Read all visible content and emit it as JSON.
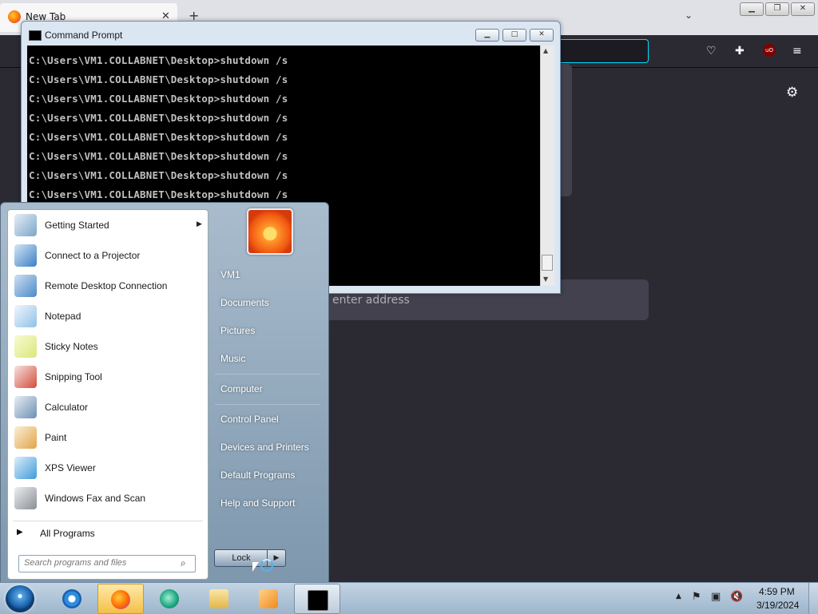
{
  "firefox": {
    "tab_title": "New Tab",
    "tab_close": "✕",
    "new_tab": "+",
    "list_tabs": "⌄",
    "search_placeholder": "enter address",
    "ublock_label": "uO",
    "icons": [
      "pocket-icon",
      "extensions-icon",
      "ublock-icon",
      "menu-icon",
      "settings-gear-icon"
    ]
  },
  "outer_window": {
    "minimize": "▁",
    "maximize": "❐",
    "close": "✕"
  },
  "cmd": {
    "title": "Command Prompt",
    "minimize": "▁",
    "maximize": "□",
    "close": "✕",
    "lines": [
      "C:\\Users\\VM1.COLLABNET\\Desktop>shutdown /s",
      "C:\\Users\\VM1.COLLABNET\\Desktop>shutdown /s",
      "C:\\Users\\VM1.COLLABNET\\Desktop>shutdown /s",
      "C:\\Users\\VM1.COLLABNET\\Desktop>shutdown /s",
      "C:\\Users\\VM1.COLLABNET\\Desktop>shutdown /s",
      "C:\\Users\\VM1.COLLABNET\\Desktop>shutdown /s",
      "C:\\Users\\VM1.COLLABNET\\Desktop>shutdown /s",
      "C:\\Users\\VM1.COLLABNET\\Desktop>shutdown /s"
    ]
  },
  "start_menu": {
    "programs": [
      {
        "label": "Getting Started",
        "icon": "getting-started-icon",
        "color": "#7aa6c9"
      },
      {
        "label": "Connect to a Projector",
        "icon": "projector-icon",
        "color": "#3b7fc4"
      },
      {
        "label": "Remote Desktop Connection",
        "icon": "remote-desktop-icon",
        "color": "#4b89c8"
      },
      {
        "label": "Notepad",
        "icon": "notepad-icon",
        "color": "#8fc0e8"
      },
      {
        "label": "Sticky Notes",
        "icon": "sticky-notes-icon",
        "color": "#d9e77a"
      },
      {
        "label": "Snipping Tool",
        "icon": "snipping-tool-icon",
        "color": "#d44c3c"
      },
      {
        "label": "Calculator",
        "icon": "calculator-icon",
        "color": "#6d8fb3"
      },
      {
        "label": "Paint",
        "icon": "paint-icon",
        "color": "#e0a548"
      },
      {
        "label": "XPS Viewer",
        "icon": "xps-viewer-icon",
        "color": "#3f9bd9"
      },
      {
        "label": "Windows Fax and Scan",
        "icon": "fax-scan-icon",
        "color": "#8a8f96"
      }
    ],
    "getting_started_arrow": "▶",
    "all_programs_arrow": "▶",
    "all_programs": "All Programs",
    "search_placeholder": "Search programs and files",
    "search_icon": "⌕",
    "right_links": [
      "VM1",
      "Documents",
      "Pictures",
      "Music",
      "Computer",
      "Control Panel",
      "Devices and Printers",
      "Default Programs",
      "Help and Support"
    ],
    "lock_label": "Lock",
    "lock_arrow": "▶"
  },
  "taskbar": {
    "tray_arrow": "▲",
    "time": "4:59 PM",
    "date": "3/19/2024"
  }
}
